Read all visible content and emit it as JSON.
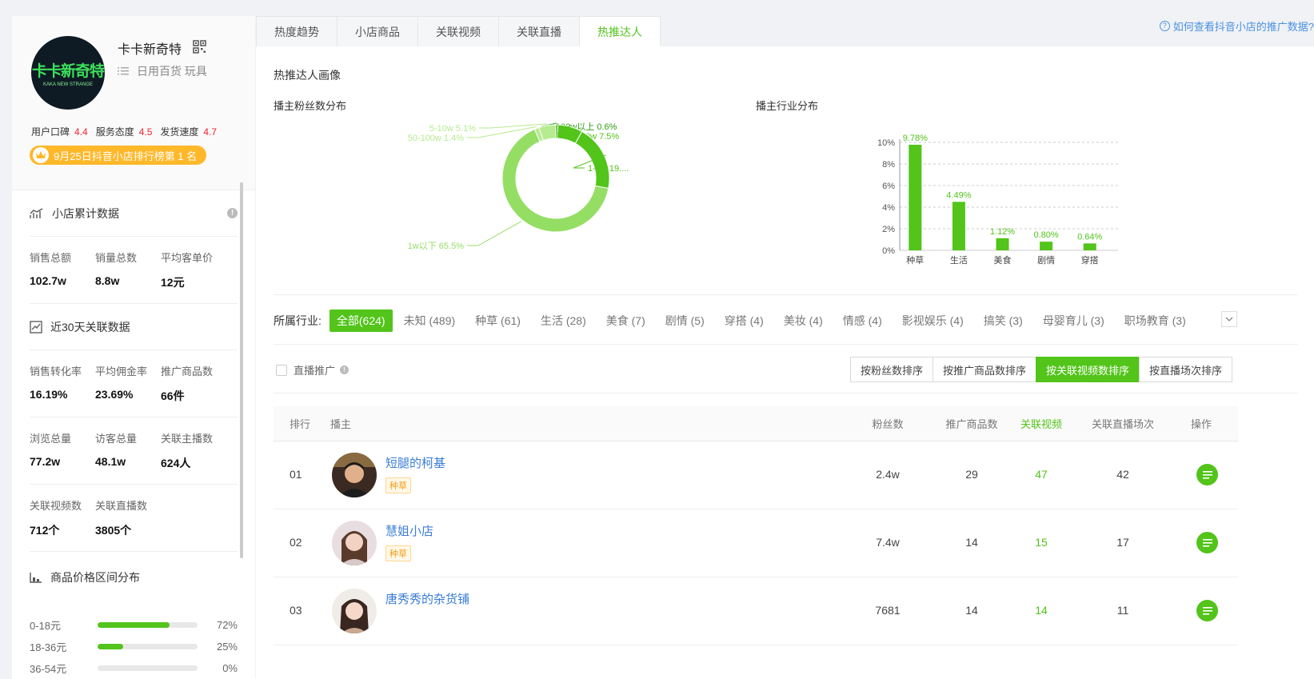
{
  "shop": {
    "logo_text": "卡卡新奇特",
    "logo_sub": "KAKA NEW STRANGE",
    "name": "卡卡新奇特",
    "categories": "日用百货 玩具",
    "ratings": [
      {
        "label": "用户口碑",
        "value": "4.4"
      },
      {
        "label": "服务态度",
        "value": "4.5"
      },
      {
        "label": "发货速度",
        "value": "4.7"
      }
    ],
    "rank_badge": "9月25日抖音小店排行榜第 1 名"
  },
  "sections": {
    "cumulative": {
      "title": "小店累计数据",
      "stats": [
        {
          "label": "销售总额",
          "value": "102.7w"
        },
        {
          "label": "销量总数",
          "value": "8.8w"
        },
        {
          "label": "平均客单价",
          "value": "12元"
        }
      ]
    },
    "last30": {
      "title": "近30天关联数据",
      "rows": [
        [
          {
            "label": "销售转化率",
            "value": "16.19%"
          },
          {
            "label": "平均佣金率",
            "value": "23.69%"
          },
          {
            "label": "推广商品数",
            "value": "66件"
          }
        ],
        [
          {
            "label": "浏览总量",
            "value": "77.2w"
          },
          {
            "label": "访客总量",
            "value": "48.1w"
          },
          {
            "label": "关联主播数",
            "value": "624人"
          }
        ],
        [
          {
            "label": "关联视频数",
            "value": "712个"
          },
          {
            "label": "关联直播数",
            "value": "3805个"
          }
        ]
      ]
    },
    "price": {
      "title": "商品价格区间分布",
      "rows": [
        {
          "label": "0-18元",
          "pct": "72%",
          "fill": 0.72
        },
        {
          "label": "18-36元",
          "pct": "25%",
          "fill": 0.25
        },
        {
          "label": "36-54元",
          "pct": "0%",
          "fill": 0
        }
      ]
    }
  },
  "tabs": [
    "热度趋势",
    "小店商品",
    "关联视频",
    "关联直播",
    "热推达人"
  ],
  "active_tab": 4,
  "help_link": "如何查看抖音小店的推广数据?",
  "persona": {
    "title": "热推达人画像",
    "fans_title": "播主粉丝数分布",
    "industry_title": "播主行业分布"
  },
  "chart_data": [
    {
      "type": "pie",
      "title": "播主粉丝数分布",
      "labels": [
        "100w以上",
        "10-50w",
        "1-5w",
        "1w以下",
        "50-100w",
        "5-10w"
      ],
      "values": [
        0.6,
        7.5,
        19.9,
        65.5,
        1.4,
        5.1
      ],
      "display_labels": [
        "100w以上 0.6%",
        "10-50w 7.5%",
        "1-5w 19....",
        "1w以下 65.5%",
        "50-100w 1.4%",
        "5-10w 5.1%"
      ],
      "colors": [
        "#2e9e10",
        "#52c41a",
        "#52c41a",
        "#95de64",
        "#b7eb8f",
        "#b7eb8f"
      ]
    },
    {
      "type": "bar",
      "title": "播主行业分布",
      "categories": [
        "种草",
        "生活",
        "美食",
        "剧情",
        "穿搭"
      ],
      "values": [
        9.78,
        4.49,
        1.12,
        0.8,
        0.64
      ],
      "value_labels": [
        "9.78%",
        "4.49%",
        "1.12%",
        "0.80%",
        "0.64%"
      ],
      "yticks": [
        "0%",
        "2%",
        "4%",
        "6%",
        "8%",
        "10%"
      ],
      "ylim": [
        0,
        10
      ],
      "color": "#52c41a"
    }
  ],
  "industry_filter": {
    "label": "所属行业:",
    "items": [
      "全部(624)",
      "未知 (489)",
      "种草 (61)",
      "生活 (28)",
      "美食 (7)",
      "剧情 (5)",
      "穿搭 (4)",
      "美妆 (4)",
      "情感 (4)",
      "影视娱乐 (4)",
      "搞笑 (3)",
      "母婴育儿 (3)",
      "职场教育 (3)"
    ]
  },
  "live_promo": "直播推广",
  "sort_buttons": [
    "按粉丝数排序",
    "按推广商品数排序",
    "按关联视频数排序",
    "按直播场次排序"
  ],
  "active_sort": 2,
  "table": {
    "headers": {
      "rank": "排行",
      "anchor": "播主",
      "fans": "粉丝数",
      "goods": "推广商品数",
      "video": "关联视频",
      "live": "关联直播场次",
      "op": "操作"
    },
    "rows": [
      {
        "rank": "01",
        "name": "短腿的柯基",
        "tag": "种草",
        "fans": "2.4w",
        "goods": "29",
        "video": "47",
        "live": "42"
      },
      {
        "rank": "02",
        "name": "慧姐小店",
        "tag": "种草",
        "fans": "7.4w",
        "goods": "14",
        "video": "15",
        "live": "17"
      },
      {
        "rank": "03",
        "name": "唐秀秀的杂货铺",
        "tag": "",
        "fans": "7681",
        "goods": "14",
        "video": "14",
        "live": "11"
      }
    ]
  }
}
